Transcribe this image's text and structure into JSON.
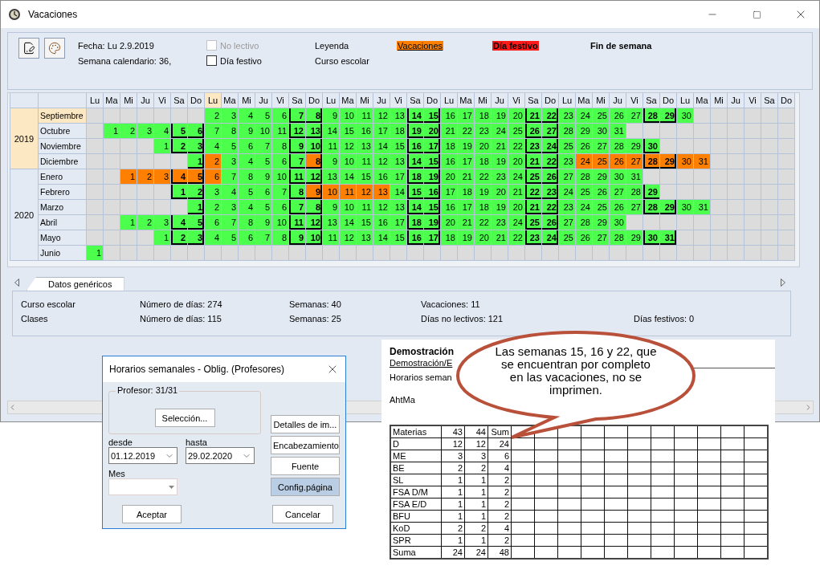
{
  "window": {
    "title": "Vacaciones"
  },
  "toolbar": {
    "date": "Fecha: Lu 2.9.2019",
    "week": "Semana calendario: 36,",
    "checkboxes": [
      {
        "label": "No lectivo",
        "checked": false,
        "disabled": true
      },
      {
        "label": "Día festivo",
        "checked": false,
        "disabled": false
      }
    ],
    "legend_title": "Leyenda",
    "school_year": "Curso escolar",
    "legend": [
      {
        "label": "Vacaciones",
        "kind": "vacation"
      },
      {
        "label": "Día festivo",
        "kind": "holiday"
      },
      {
        "label": "Fin de semana",
        "kind": "weekend"
      }
    ]
  },
  "calendar": {
    "weekdays": [
      {
        "label": "Lu",
        "current": false
      },
      {
        "label": "Ma",
        "current": false
      },
      {
        "label": "Mi",
        "current": false
      },
      {
        "label": "Ju",
        "current": false
      },
      {
        "label": "Vi",
        "current": false
      },
      {
        "label": "Sa",
        "current": false
      },
      {
        "label": "Do",
        "current": false
      },
      {
        "label": "Lu",
        "current": true
      },
      {
        "label": "Ma",
        "current": false
      },
      {
        "label": "Mi",
        "current": false
      },
      {
        "label": "Ju",
        "current": false
      },
      {
        "label": "Vi",
        "current": false
      },
      {
        "label": "Sa",
        "current": false
      },
      {
        "label": "Do",
        "current": false
      },
      {
        "label": "Lu",
        "current": false
      },
      {
        "label": "Ma",
        "current": false
      },
      {
        "label": "Mi",
        "current": false
      },
      {
        "label": "Ju",
        "current": false
      },
      {
        "label": "Vi",
        "current": false
      },
      {
        "label": "Sa",
        "current": false
      },
      {
        "label": "Do",
        "current": false
      },
      {
        "label": "Lu",
        "current": false
      },
      {
        "label": "Ma",
        "current": false
      },
      {
        "label": "Mi",
        "current": false
      },
      {
        "label": "Ju",
        "current": false
      },
      {
        "label": "Vi",
        "current": false
      },
      {
        "label": "Sa",
        "current": false
      },
      {
        "label": "Do",
        "current": false
      },
      {
        "label": "Lu",
        "current": false
      },
      {
        "label": "Ma",
        "current": false
      },
      {
        "label": "Mi",
        "current": false
      },
      {
        "label": "Ju",
        "current": false
      },
      {
        "label": "Vi",
        "current": false
      },
      {
        "label": "Sa",
        "current": false
      },
      {
        "label": "Do",
        "current": false
      },
      {
        "label": "Lu",
        "current": false
      },
      {
        "label": "Ma",
        "current": false
      },
      {
        "label": "Mi",
        "current": false
      },
      {
        "label": "Ju",
        "current": false
      },
      {
        "label": "Vi",
        "current": false
      },
      {
        "label": "Sa",
        "current": false
      },
      {
        "label": "Do",
        "current": false
      }
    ],
    "years": [
      {
        "year": "2019",
        "current": true,
        "months": [
          {
            "name": "Septiembre",
            "current": true,
            "cells": [
              null,
              null,
              null,
              null,
              null,
              null,
              null,
              {
                "day": "2",
                "vacation": false
              },
              {
                "day": "3",
                "vacation": false
              },
              {
                "day": "4",
                "vacation": false
              },
              {
                "day": "5",
                "vacation": false
              },
              {
                "day": "6",
                "vacation": false
              },
              {
                "day": "7",
                "vacation": false
              },
              {
                "day": "8",
                "vacation": false
              },
              {
                "day": "9",
                "vacation": false
              },
              {
                "day": "10",
                "vacation": false
              },
              {
                "day": "11",
                "vacation": false
              },
              {
                "day": "12",
                "vacation": false
              },
              {
                "day": "13",
                "vacation": false
              },
              {
                "day": "14",
                "vacation": false
              },
              {
                "day": "15",
                "vacation": false
              },
              {
                "day": "16",
                "vacation": false
              },
              {
                "day": "17",
                "vacation": false
              },
              {
                "day": "18",
                "vacation": false
              },
              {
                "day": "19",
                "vacation": false
              },
              {
                "day": "20",
                "vacation": false
              },
              {
                "day": "21",
                "vacation": false
              },
              {
                "day": "22",
                "vacation": false
              },
              {
                "day": "23",
                "vacation": false
              },
              {
                "day": "24",
                "vacation": false
              },
              {
                "day": "25",
                "vacation": false
              },
              {
                "day": "26",
                "vacation": false
              },
              {
                "day": "27",
                "vacation": false
              },
              {
                "day": "28",
                "vacation": false
              },
              {
                "day": "29",
                "vacation": false
              },
              {
                "day": "30",
                "vacation": false
              }
            ]
          },
          {
            "name": "Octubre",
            "current": false,
            "cells": [
              null,
              {
                "day": "1",
                "vacation": false
              },
              {
                "day": "2",
                "vacation": false
              },
              {
                "day": "3",
                "vacation": false
              },
              {
                "day": "4",
                "vacation": false
              },
              {
                "day": "5",
                "vacation": false
              },
              {
                "day": "6",
                "vacation": false
              },
              {
                "day": "7",
                "vacation": false
              },
              {
                "day": "8",
                "vacation": false
              },
              {
                "day": "9",
                "vacation": false
              },
              {
                "day": "10",
                "vacation": false
              },
              {
                "day": "11",
                "vacation": false
              },
              {
                "day": "12",
                "vacation": false
              },
              {
                "day": "13",
                "vacation": false
              },
              {
                "day": "14",
                "vacation": false
              },
              {
                "day": "15",
                "vacation": false
              },
              {
                "day": "16",
                "vacation": false
              },
              {
                "day": "17",
                "vacation": false
              },
              {
                "day": "18",
                "vacation": false
              },
              {
                "day": "19",
                "vacation": false
              },
              {
                "day": "20",
                "vacation": false
              },
              {
                "day": "21",
                "vacation": false
              },
              {
                "day": "22",
                "vacation": false
              },
              {
                "day": "23",
                "vacation": false
              },
              {
                "day": "24",
                "vacation": false
              },
              {
                "day": "25",
                "vacation": false
              },
              {
                "day": "26",
                "vacation": false
              },
              {
                "day": "27",
                "vacation": false
              },
              {
                "day": "28",
                "vacation": false
              },
              {
                "day": "29",
                "vacation": false
              },
              {
                "day": "30",
                "vacation": false
              },
              {
                "day": "31",
                "vacation": false
              }
            ]
          },
          {
            "name": "Noviembre",
            "current": false,
            "cells": [
              null,
              null,
              null,
              null,
              {
                "day": "1",
                "vacation": false
              },
              {
                "day": "2",
                "vacation": false
              },
              {
                "day": "3",
                "vacation": false
              },
              {
                "day": "4",
                "vacation": false
              },
              {
                "day": "5",
                "vacation": false
              },
              {
                "day": "6",
                "vacation": false
              },
              {
                "day": "7",
                "vacation": false
              },
              {
                "day": "8",
                "vacation": false
              },
              {
                "day": "9",
                "vacation": false
              },
              {
                "day": "10",
                "vacation": false
              },
              {
                "day": "11",
                "vacation": false
              },
              {
                "day": "12",
                "vacation": false
              },
              {
                "day": "13",
                "vacation": false
              },
              {
                "day": "14",
                "vacation": false
              },
              {
                "day": "15",
                "vacation": false
              },
              {
                "day": "16",
                "vacation": false
              },
              {
                "day": "17",
                "vacation": false
              },
              {
                "day": "18",
                "vacation": false
              },
              {
                "day": "19",
                "vacation": false
              },
              {
                "day": "20",
                "vacation": false
              },
              {
                "day": "21",
                "vacation": false
              },
              {
                "day": "22",
                "vacation": false
              },
              {
                "day": "23",
                "vacation": false
              },
              {
                "day": "24",
                "vacation": false
              },
              {
                "day": "25",
                "vacation": false
              },
              {
                "day": "26",
                "vacation": false
              },
              {
                "day": "27",
                "vacation": false
              },
              {
                "day": "28",
                "vacation": false
              },
              {
                "day": "29",
                "vacation": false
              },
              {
                "day": "30",
                "vacation": false
              }
            ]
          },
          {
            "name": "Diciembre",
            "current": false,
            "cells": [
              null,
              null,
              null,
              null,
              null,
              null,
              {
                "day": "1",
                "vacation": false
              },
              {
                "day": "2",
                "vacation": true
              },
              {
                "day": "3",
                "vacation": false
              },
              {
                "day": "4",
                "vacation": false
              },
              {
                "day": "5",
                "vacation": false
              },
              {
                "day": "6",
                "vacation": false
              },
              {
                "day": "7",
                "vacation": false
              },
              {
                "day": "8",
                "vacation": true
              },
              {
                "day": "9",
                "vacation": false
              },
              {
                "day": "10",
                "vacation": false
              },
              {
                "day": "11",
                "vacation": false
              },
              {
                "day": "12",
                "vacation": false
              },
              {
                "day": "13",
                "vacation": false
              },
              {
                "day": "14",
                "vacation": false
              },
              {
                "day": "15",
                "vacation": false
              },
              {
                "day": "16",
                "vacation": false
              },
              {
                "day": "17",
                "vacation": false
              },
              {
                "day": "18",
                "vacation": false
              },
              {
                "day": "19",
                "vacation": false
              },
              {
                "day": "20",
                "vacation": false
              },
              {
                "day": "21",
                "vacation": false
              },
              {
                "day": "22",
                "vacation": false
              },
              {
                "day": "23",
                "vacation": false
              },
              {
                "day": "24",
                "vacation": true
              },
              {
                "day": "25",
                "vacation": true
              },
              {
                "day": "26",
                "vacation": true
              },
              {
                "day": "27",
                "vacation": true
              },
              {
                "day": "28",
                "vacation": true
              },
              {
                "day": "29",
                "vacation": true
              },
              {
                "day": "30",
                "vacation": true
              },
              {
                "day": "31",
                "vacation": true
              }
            ]
          }
        ]
      },
      {
        "year": "2020",
        "current": false,
        "months": [
          {
            "name": "Enero",
            "current": false,
            "cells": [
              null,
              null,
              {
                "day": "1",
                "vacation": true
              },
              {
                "day": "2",
                "vacation": true
              },
              {
                "day": "3",
                "vacation": true
              },
              {
                "day": "4",
                "vacation": true
              },
              {
                "day": "5",
                "vacation": true
              },
              {
                "day": "6",
                "vacation": true
              },
              {
                "day": "7",
                "vacation": false
              },
              {
                "day": "8",
                "vacation": false
              },
              {
                "day": "9",
                "vacation": false
              },
              {
                "day": "10",
                "vacation": false
              },
              {
                "day": "11",
                "vacation": false
              },
              {
                "day": "12",
                "vacation": false
              },
              {
                "day": "13",
                "vacation": false
              },
              {
                "day": "14",
                "vacation": false
              },
              {
                "day": "15",
                "vacation": false
              },
              {
                "day": "16",
                "vacation": false
              },
              {
                "day": "17",
                "vacation": false
              },
              {
                "day": "18",
                "vacation": false
              },
              {
                "day": "19",
                "vacation": false
              },
              {
                "day": "20",
                "vacation": false
              },
              {
                "day": "21",
                "vacation": false
              },
              {
                "day": "22",
                "vacation": false
              },
              {
                "day": "23",
                "vacation": false
              },
              {
                "day": "24",
                "vacation": false
              },
              {
                "day": "25",
                "vacation": false
              },
              {
                "day": "26",
                "vacation": false
              },
              {
                "day": "27",
                "vacation": false
              },
              {
                "day": "28",
                "vacation": false
              },
              {
                "day": "29",
                "vacation": false
              },
              {
                "day": "30",
                "vacation": false
              },
              {
                "day": "31",
                "vacation": false
              }
            ]
          },
          {
            "name": "Febrero",
            "current": false,
            "cells": [
              null,
              null,
              null,
              null,
              null,
              {
                "day": "1",
                "vacation": false
              },
              {
                "day": "2",
                "vacation": false
              },
              {
                "day": "3",
                "vacation": false
              },
              {
                "day": "4",
                "vacation": false
              },
              {
                "day": "5",
                "vacation": false
              },
              {
                "day": "6",
                "vacation": false
              },
              {
                "day": "7",
                "vacation": false
              },
              {
                "day": "8",
                "vacation": false
              },
              {
                "day": "9",
                "vacation": true
              },
              {
                "day": "10",
                "vacation": true
              },
              {
                "day": "11",
                "vacation": true
              },
              {
                "day": "12",
                "vacation": true
              },
              {
                "day": "13",
                "vacation": true
              },
              {
                "day": "14",
                "vacation": false
              },
              {
                "day": "15",
                "vacation": false
              },
              {
                "day": "16",
                "vacation": false
              },
              {
                "day": "17",
                "vacation": false
              },
              {
                "day": "18",
                "vacation": false
              },
              {
                "day": "19",
                "vacation": false
              },
              {
                "day": "20",
                "vacation": false
              },
              {
                "day": "21",
                "vacation": false
              },
              {
                "day": "22",
                "vacation": false
              },
              {
                "day": "23",
                "vacation": false
              },
              {
                "day": "24",
                "vacation": false
              },
              {
                "day": "25",
                "vacation": false
              },
              {
                "day": "26",
                "vacation": false
              },
              {
                "day": "27",
                "vacation": false
              },
              {
                "day": "28",
                "vacation": false
              },
              {
                "day": "29",
                "vacation": false
              }
            ]
          },
          {
            "name": "Marzo",
            "current": false,
            "cells": [
              null,
              null,
              null,
              null,
              null,
              null,
              {
                "day": "1",
                "vacation": false
              },
              {
                "day": "2",
                "vacation": false
              },
              {
                "day": "3",
                "vacation": false
              },
              {
                "day": "4",
                "vacation": false
              },
              {
                "day": "5",
                "vacation": false
              },
              {
                "day": "6",
                "vacation": false
              },
              {
                "day": "7",
                "vacation": false
              },
              {
                "day": "8",
                "vacation": false
              },
              {
                "day": "9",
                "vacation": false
              },
              {
                "day": "10",
                "vacation": false
              },
              {
                "day": "11",
                "vacation": false
              },
              {
                "day": "12",
                "vacation": false
              },
              {
                "day": "13",
                "vacation": false
              },
              {
                "day": "14",
                "vacation": false
              },
              {
                "day": "15",
                "vacation": false
              },
              {
                "day": "16",
                "vacation": false
              },
              {
                "day": "17",
                "vacation": false
              },
              {
                "day": "18",
                "vacation": false
              },
              {
                "day": "19",
                "vacation": false
              },
              {
                "day": "20",
                "vacation": false
              },
              {
                "day": "21",
                "vacation": false
              },
              {
                "day": "22",
                "vacation": false
              },
              {
                "day": "23",
                "vacation": false
              },
              {
                "day": "24",
                "vacation": false
              },
              {
                "day": "25",
                "vacation": false
              },
              {
                "day": "26",
                "vacation": false
              },
              {
                "day": "27",
                "vacation": false
              },
              {
                "day": "28",
                "vacation": false
              },
              {
                "day": "29",
                "vacation": false
              },
              {
                "day": "30",
                "vacation": false
              },
              {
                "day": "31",
                "vacation": false
              }
            ]
          },
          {
            "name": "Abril",
            "current": false,
            "cells": [
              null,
              null,
              {
                "day": "1",
                "vacation": false
              },
              {
                "day": "2",
                "vacation": false
              },
              {
                "day": "3",
                "vacation": false
              },
              {
                "day": "4",
                "vacation": false
              },
              {
                "day": "5",
                "vacation": false
              },
              {
                "day": "6",
                "vacation": false
              },
              {
                "day": "7",
                "vacation": false
              },
              {
                "day": "8",
                "vacation": false
              },
              {
                "day": "9",
                "vacation": false
              },
              {
                "day": "10",
                "vacation": false
              },
              {
                "day": "11",
                "vacation": false
              },
              {
                "day": "12",
                "vacation": false
              },
              {
                "day": "13",
                "vacation": false
              },
              {
                "day": "14",
                "vacation": false
              },
              {
                "day": "15",
                "vacation": false
              },
              {
                "day": "16",
                "vacation": false
              },
              {
                "day": "17",
                "vacation": false
              },
              {
                "day": "18",
                "vacation": false
              },
              {
                "day": "19",
                "vacation": false
              },
              {
                "day": "20",
                "vacation": false
              },
              {
                "day": "21",
                "vacation": false
              },
              {
                "day": "22",
                "vacation": false
              },
              {
                "day": "23",
                "vacation": false
              },
              {
                "day": "24",
                "vacation": false
              },
              {
                "day": "25",
                "vacation": false
              },
              {
                "day": "26",
                "vacation": false
              },
              {
                "day": "27",
                "vacation": false
              },
              {
                "day": "28",
                "vacation": false
              },
              {
                "day": "29",
                "vacation": false
              },
              {
                "day": "30",
                "vacation": false
              }
            ]
          },
          {
            "name": "Mayo",
            "current": false,
            "cells": [
              null,
              null,
              null,
              null,
              {
                "day": "1",
                "vacation": false
              },
              {
                "day": "2",
                "vacation": false
              },
              {
                "day": "3",
                "vacation": false
              },
              {
                "day": "4",
                "vacation": false
              },
              {
                "day": "5",
                "vacation": false
              },
              {
                "day": "6",
                "vacation": false
              },
              {
                "day": "7",
                "vacation": false
              },
              {
                "day": "8",
                "vacation": false
              },
              {
                "day": "9",
                "vacation": false
              },
              {
                "day": "10",
                "vacation": false
              },
              {
                "day": "11",
                "vacation": false
              },
              {
                "day": "12",
                "vacation": false
              },
              {
                "day": "13",
                "vacation": false
              },
              {
                "day": "14",
                "vacation": false
              },
              {
                "day": "15",
                "vacation": false
              },
              {
                "day": "16",
                "vacation": false
              },
              {
                "day": "17",
                "vacation": false
              },
              {
                "day": "18",
                "vacation": false
              },
              {
                "day": "19",
                "vacation": false
              },
              {
                "day": "20",
                "vacation": false
              },
              {
                "day": "21",
                "vacation": false
              },
              {
                "day": "22",
                "vacation": false
              },
              {
                "day": "23",
                "vacation": false
              },
              {
                "day": "24",
                "vacation": false
              },
              {
                "day": "25",
                "vacation": false
              },
              {
                "day": "26",
                "vacation": false
              },
              {
                "day": "27",
                "vacation": false
              },
              {
                "day": "28",
                "vacation": false
              },
              {
                "day": "29",
                "vacation": false
              },
              {
                "day": "30",
                "vacation": false
              },
              {
                "day": "31",
                "vacation": false
              }
            ]
          },
          {
            "name": "Junio",
            "current": false,
            "cells": [
              {
                "day": "1",
                "vacation": false
              }
            ]
          }
        ]
      }
    ]
  },
  "tabs": [
    {
      "label": "Datos genéricos",
      "selected": true
    }
  ],
  "stats": [
    [
      "Curso escolar",
      "Número de días: 274",
      "Semanas: 40",
      "Vacaciones: 11"
    ],
    [
      "Clases",
      "Número de días: 115",
      "Semanas: 25",
      "Días no lectivos: 121",
      "Días festivos: 0"
    ]
  ],
  "dialog": {
    "title": "Horarios semanales - Oblig. (Profesores)",
    "group_label": "Profesor: 31/31",
    "selection_button": "Selección...",
    "from_label": "desde",
    "from_value": "01.12.2019",
    "to_label": "hasta",
    "to_value": "29.02.2020",
    "month_label": "Mes",
    "side_buttons": [
      {
        "label": "Detalles de im...",
        "selected": false
      },
      {
        "label": "Encabezamiento",
        "selected": false
      },
      {
        "label": "Fuente",
        "selected": false
      },
      {
        "label": "Config.página",
        "selected": true
      }
    ],
    "ok": "Aceptar",
    "cancel": "Cancelar"
  },
  "report": {
    "title": "Demostración",
    "subtitle": "Demostración/E",
    "heading": "Horarios seman",
    "teacher": "AhtMa",
    "columns": [
      "Materias",
      "43",
      "44",
      "Sum"
    ],
    "rows": [
      [
        "D",
        "12",
        "12",
        "24"
      ],
      [
        "ME",
        "3",
        "3",
        "6"
      ],
      [
        "BE",
        "2",
        "2",
        "4"
      ],
      [
        "SL",
        "1",
        "1",
        "2"
      ],
      [
        "FSA D/M",
        "1",
        "1",
        "2"
      ],
      [
        "FSA E/D",
        "1",
        "1",
        "2"
      ],
      [
        "BFU",
        "1",
        "1",
        "2"
      ],
      [
        "KoD",
        "2",
        "2",
        "4"
      ],
      [
        "SPR",
        "1",
        "1",
        "2"
      ],
      [
        "Suma",
        "24",
        "24",
        "48"
      ]
    ]
  },
  "callout": {
    "text": "Las semanas 15, 16 y 22, que\nse encuentran por completo\nen las vacaciones, no se\nimprimen."
  }
}
